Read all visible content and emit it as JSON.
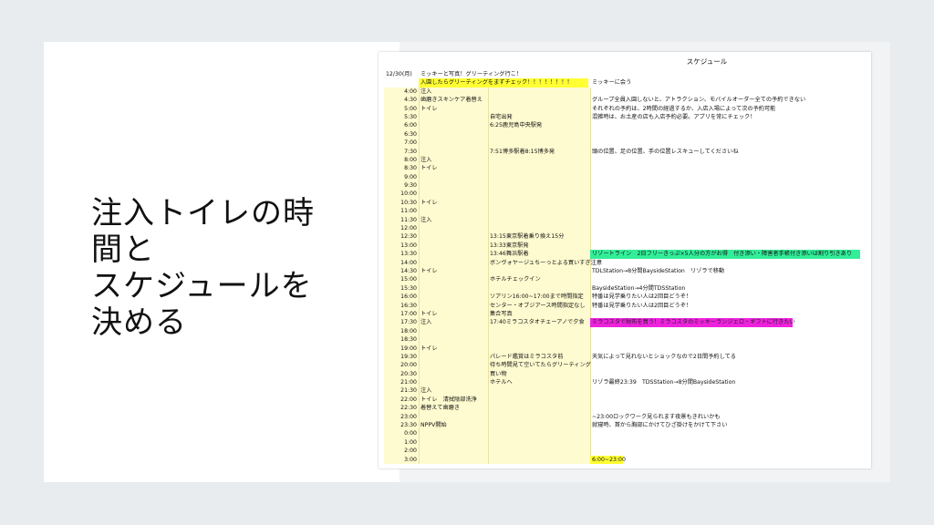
{
  "slide": {
    "title": "注入トイレの時\n間と\nスケジュールを\n決める"
  },
  "sheet": {
    "title": "スケジュール",
    "date": "12/30(月)",
    "date_note": "ミッキーと写真！グリーティング行こ！",
    "banner": "入園したらグリーティングをまずチェック！！！！！！！！",
    "banner_right": "ミッキーに会う",
    "rows": [
      {
        "time": "4:00",
        "col2": "注入",
        "col3": "",
        "col4": ""
      },
      {
        "time": "4:30",
        "col2": "歯磨きスキンケア着替え",
        "col3": "",
        "col4": "グループ全員入園しないと、アトラクション、モバイルオーダー全ての予約できない"
      },
      {
        "time": "5:00",
        "col2": "トイレ",
        "col3": "",
        "col4": "それぞれの予約は、2時間の経過するか、入店入場によって次の予約可能"
      },
      {
        "time": "5:30",
        "col2": "",
        "col3": "自宅出発",
        "col4": "混雑時は、お土産の店も入店予約必要。アプリを常にチェック！"
      },
      {
        "time": "6:00",
        "col2": "",
        "col3": "6:25鹿児島中央駅発",
        "col4": ""
      },
      {
        "time": "6:30",
        "col2": "",
        "col3": "",
        "col4": ""
      },
      {
        "time": "7:00",
        "col2": "",
        "col3": "",
        "col4": ""
      },
      {
        "time": "7:30",
        "col2": "",
        "col3": "7:51博多駅着8:15博多発",
        "col4": "頭の位置、足の位置、手の位置レスキューしてくださいね"
      },
      {
        "time": "8:00",
        "col2": "注入",
        "col3": "",
        "col4": ""
      },
      {
        "time": "8:30",
        "col2": "トイレ",
        "col3": "",
        "col4": ""
      },
      {
        "time": "9:00",
        "col2": "",
        "col3": "",
        "col4": ""
      },
      {
        "time": "9:30",
        "col2": "",
        "col3": "",
        "col4": ""
      },
      {
        "time": "10:00",
        "col2": "",
        "col3": "",
        "col4": ""
      },
      {
        "time": "10:30",
        "col2": "トイレ",
        "col3": "",
        "col4": ""
      },
      {
        "time": "11:00",
        "col2": "",
        "col3": "",
        "col4": ""
      },
      {
        "time": "11:30",
        "col2": "注入",
        "col3": "",
        "col4": ""
      },
      {
        "time": "12:00",
        "col2": "",
        "col3": "",
        "col4": ""
      },
      {
        "time": "12:30",
        "col2": "",
        "col3": "13:15東京駅着乗り換え15分",
        "col4": ""
      },
      {
        "time": "13:00",
        "col2": "",
        "col3": "13:33東京駅発",
        "col4": ""
      },
      {
        "time": "13:30",
        "col2": "",
        "col3": "13:46舞浜駅着",
        "col4": "リゾートライン　2日フリーきっぷ×5人分の方がお得　付き添い・障害者手帳付き添いは割り引きあり",
        "hl": "green"
      },
      {
        "time": "14:00",
        "col2": "",
        "col3": "ボンヴォヤージュちーっとよる買いすぎ注意",
        "col4": ""
      },
      {
        "time": "14:30",
        "col2": "トイレ",
        "col3": "",
        "col4": "TDLStation→8分間BaysideStation　リゾラで移動"
      },
      {
        "time": "15:00",
        "col2": "",
        "col3": "ホテルチェックイン",
        "col4": ""
      },
      {
        "time": "15:30",
        "col2": "",
        "col3": "",
        "col4": "BaysideStation→4分間TDSStation"
      },
      {
        "time": "16:00",
        "col2": "",
        "col3": "ソアリン16:00~17:00まで時間指定",
        "col4": "特番は見学乗りたい人は2回目どうぞ！"
      },
      {
        "time": "16:30",
        "col2": "",
        "col3": "センター・オブジアース時間指定なし",
        "col4": "特番は見学乗りたい人は2回目どうぞ！"
      },
      {
        "time": "17:00",
        "col2": "トイレ",
        "col3": "集合写真",
        "col4": ""
      },
      {
        "time": "17:30",
        "col2": "注入",
        "col3": "17:40ミラコスタオチェーアノで夕食",
        "col4": "ミラコスタで財布を買う！ミラコスタのミッキーランジェロ・ギフトに行きたい",
        "hl": "magenta"
      },
      {
        "time": "18:00",
        "col2": "",
        "col3": "",
        "col4": ""
      },
      {
        "time": "18:30",
        "col2": "",
        "col3": "",
        "col4": ""
      },
      {
        "time": "19:00",
        "col2": "トイレ",
        "col3": "",
        "col4": ""
      },
      {
        "time": "19:30",
        "col2": "",
        "col3": "パレード鑑賞はミラコスタ前",
        "col4": "天気によって見れないとショックなので2日間予約してる"
      },
      {
        "time": "20:00",
        "col2": "",
        "col3": "待ち時間見て空いてたらグリーティング",
        "col4": ""
      },
      {
        "time": "20:30",
        "col2": "",
        "col3": "買い物",
        "col4": ""
      },
      {
        "time": "21:00",
        "col2": "",
        "col3": "ホテルへ",
        "col4": "リゾラ最終23:39　TDSStation→8分間BaysideStation"
      },
      {
        "time": "21:30",
        "col2": "注入",
        "col3": "",
        "col4": ""
      },
      {
        "time": "22:00",
        "col2": "トイレ　清拭陰部洗浄",
        "col3": "",
        "col4": ""
      },
      {
        "time": "22:30",
        "col2": "着替えて歯磨き",
        "col3": "",
        "col4": ""
      },
      {
        "time": "23:00",
        "col2": "",
        "col3": "",
        "col4": "~23:00ロックワーク見られます夜景もきれいかも"
      },
      {
        "time": "23:30",
        "col2": "NPPV開始",
        "col3": "",
        "col4": "就寝時、首から胸部にかけてひざ掛けをかけて下さい"
      },
      {
        "time": "0:00",
        "col2": "",
        "col3": "",
        "col4": ""
      },
      {
        "time": "1:00",
        "col2": "",
        "col3": "",
        "col4": ""
      },
      {
        "time": "2:00",
        "col2": "",
        "col3": "",
        "col4": ""
      },
      {
        "time": "3:00",
        "col2": "",
        "col3": "",
        "col4": "6:00~23:00",
        "hl": "yellow"
      }
    ]
  },
  "colors": {
    "cell_fill": "#fffbd0",
    "highlight_yellow": "#ffff33",
    "highlight_green": "#33ee99",
    "highlight_magenta": "#ee22dd"
  }
}
